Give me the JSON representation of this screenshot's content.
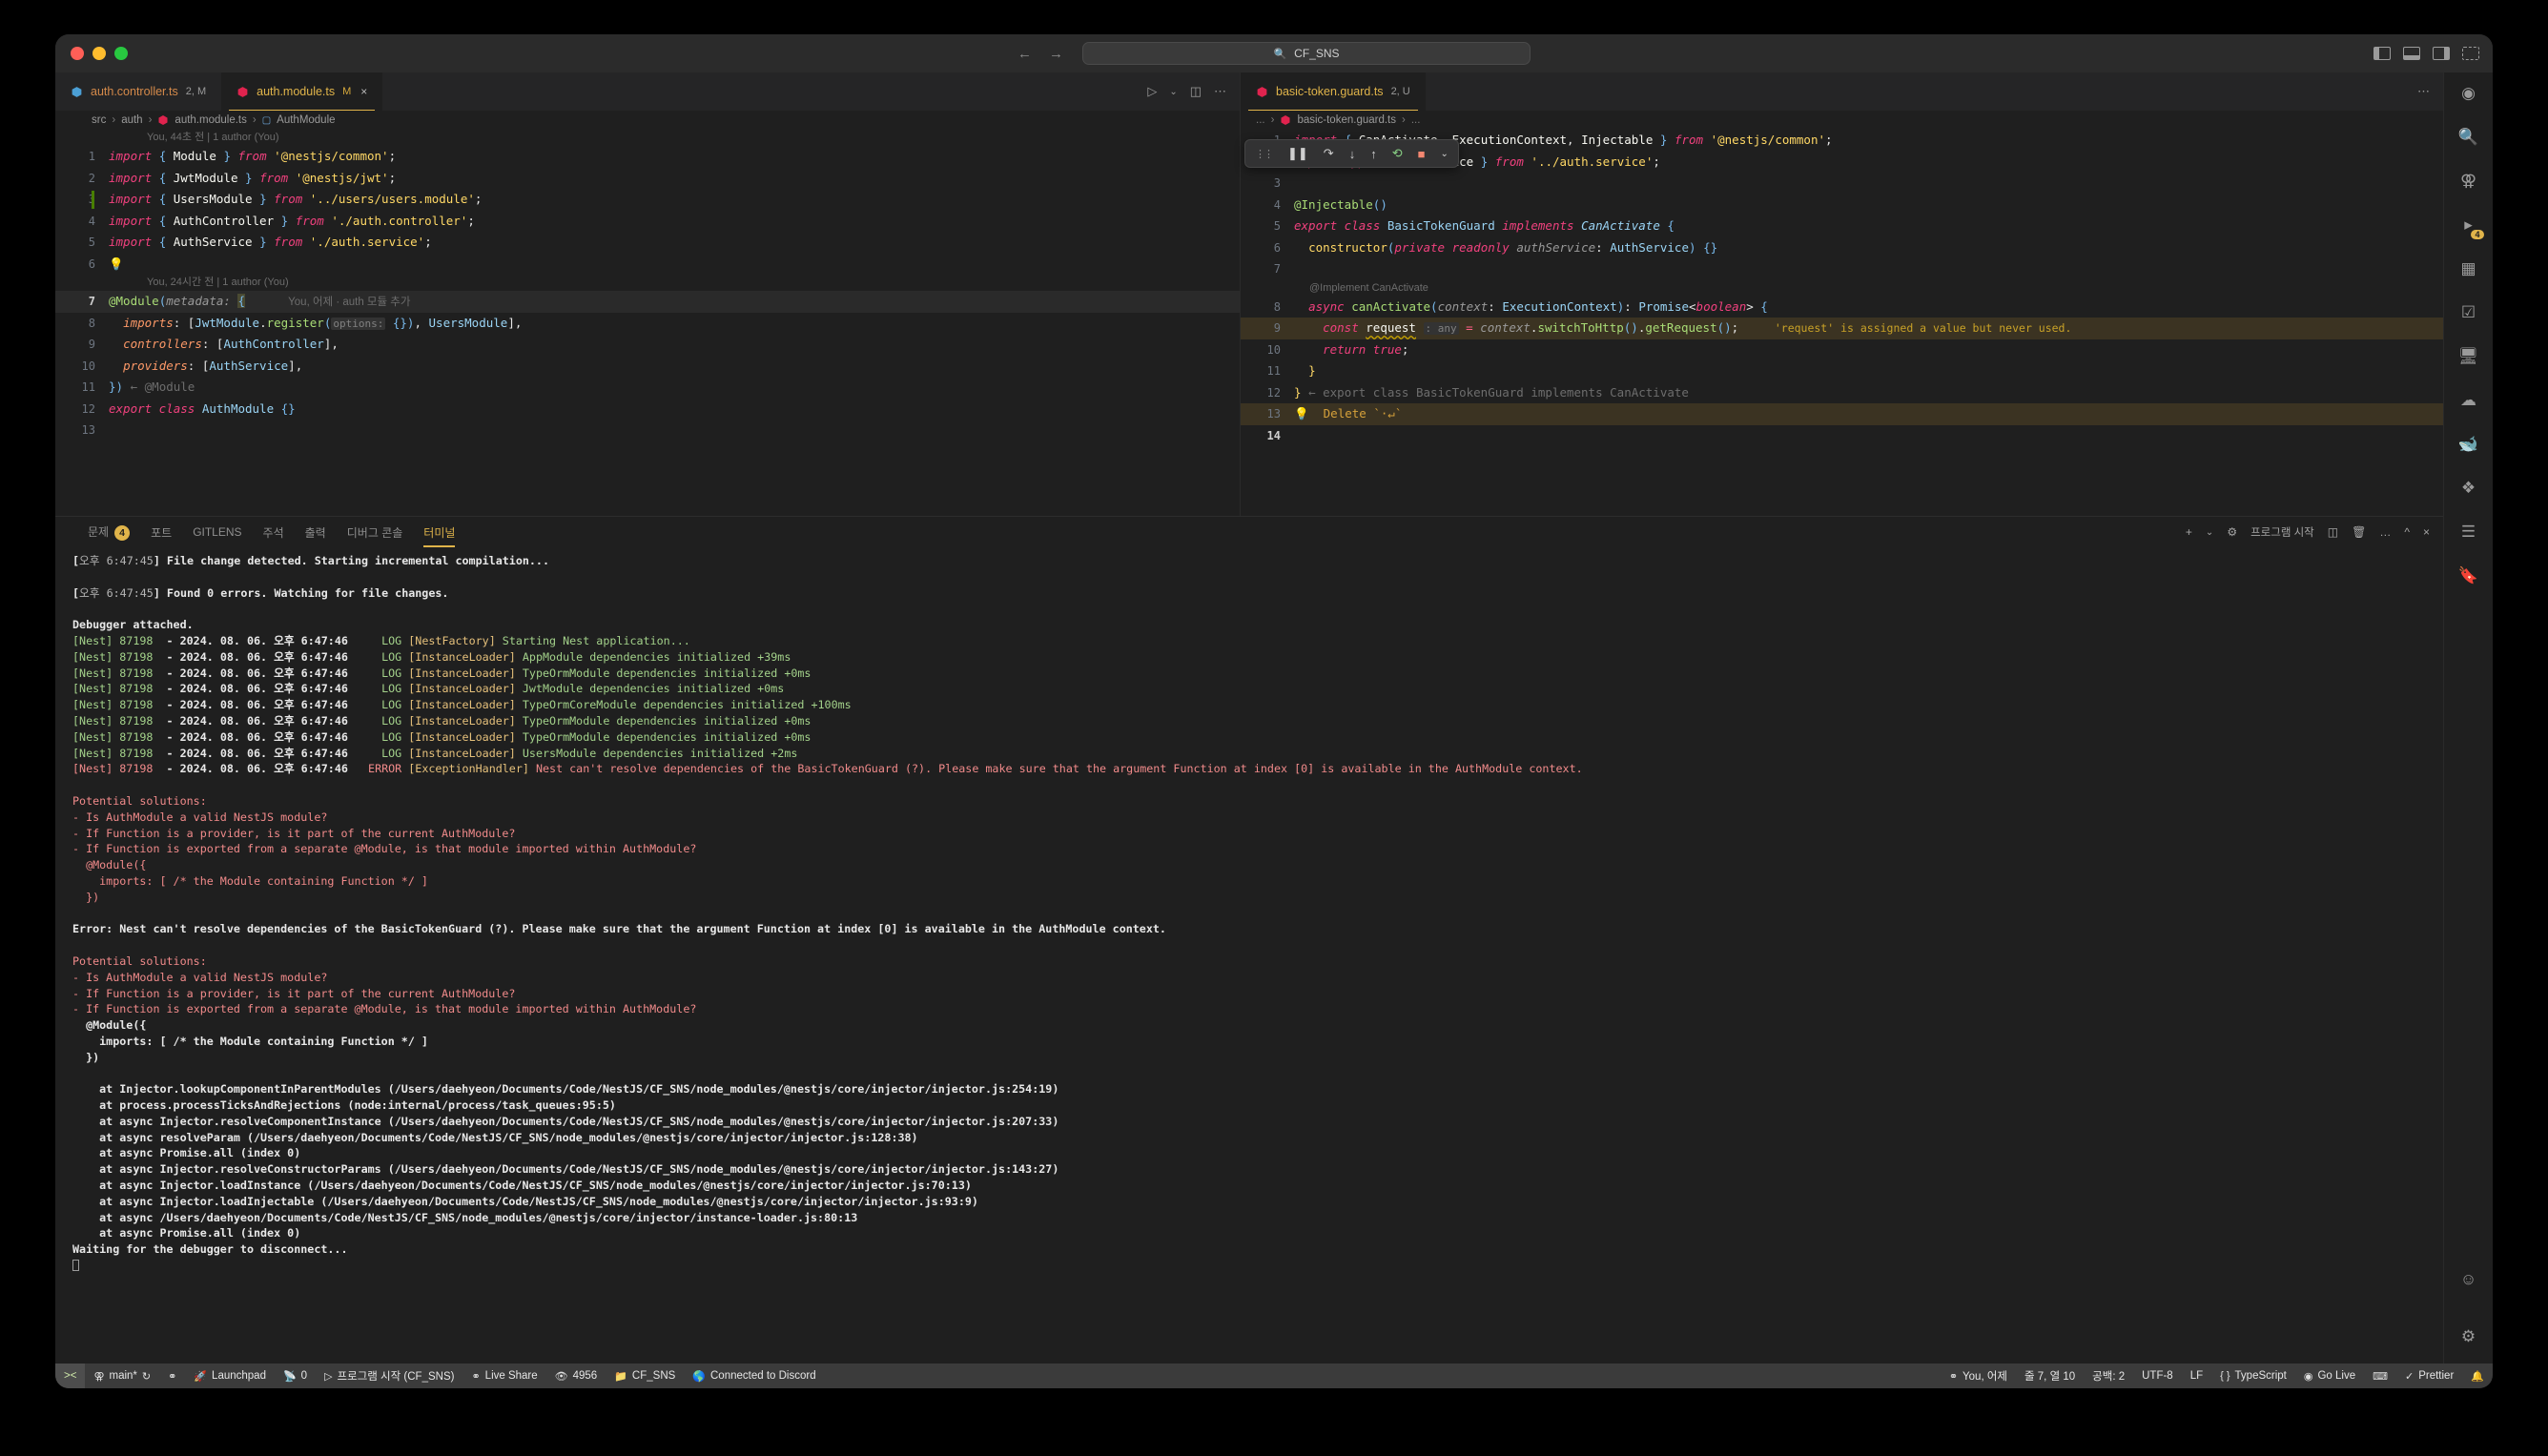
{
  "window": {
    "search_placeholder": "CF_SNS",
    "search_icon": "search-icon"
  },
  "editor_left": {
    "tabs": [
      {
        "label": "auth.controller.ts",
        "badge": "2, M",
        "active": false,
        "icon": "nestjs-icon"
      },
      {
        "label": "auth.module.ts",
        "badge": "M",
        "active": true,
        "icon": "nestjs-icon",
        "close": "×"
      }
    ],
    "breadcrumb": [
      "src",
      "auth",
      "auth.module.ts",
      "AuthModule"
    ],
    "blame": "You, 44초 전 | 1 author (You)",
    "codelens": "You, 24시간 전 | 1 author (You)",
    "inline_blame": "You, 어제 · auth 모듈 추가",
    "lines": [
      {
        "n": "1",
        "text": "import { Module } from '@nestjs/common';"
      },
      {
        "n": "2",
        "text": "import { JwtModule } from '@nestjs/jwt';"
      },
      {
        "n": "3",
        "text": "import { UsersModule } from '../users/users.module';"
      },
      {
        "n": "4",
        "text": "import { AuthController } from './auth.controller';"
      },
      {
        "n": "5",
        "text": "import { AuthService } from './auth.service';"
      },
      {
        "n": "6",
        "text": ""
      },
      {
        "n": "7",
        "text": "@Module(metadata: {"
      },
      {
        "n": "8",
        "text": "  imports: [JwtModule.register(options: {}), UsersModule],"
      },
      {
        "n": "9",
        "text": "  controllers: [AuthController],"
      },
      {
        "n": "10",
        "text": "  providers: [AuthService],"
      },
      {
        "n": "11",
        "text": "}) ← @Module"
      },
      {
        "n": "12",
        "text": "export class AuthModule {}"
      },
      {
        "n": "13",
        "text": ""
      }
    ]
  },
  "editor_right": {
    "tab": {
      "label": "basic-token.guard.ts",
      "badge": "2, U",
      "icon": "nestjs-icon"
    },
    "breadcrumb": [
      "...",
      "basic-token.guard.ts",
      "..."
    ],
    "debug_toolbar": {
      "buttons": [
        "grip",
        "pause-icon",
        "step-over-icon",
        "step-into-icon",
        "step-out-icon",
        "restart-icon",
        "stop-icon",
        "chevron-down-icon"
      ]
    },
    "codelens": "@Implement CanActivate",
    "warning_text": "'request' is assigned a value but never used.",
    "quickfix_text": "Delete `·↵`",
    "foldmsg": "← export class BasicTokenGuard implements CanActivate",
    "lines": [
      {
        "n": "1",
        "text": "import { CanActivate, ExecutionContext, Injectable } from '@nestjs/common';"
      },
      {
        "n": "2",
        "text": "import type { AuthService } from '../auth.service';"
      },
      {
        "n": "3",
        "text": ""
      },
      {
        "n": "4",
        "text": "@Injectable()"
      },
      {
        "n": "5",
        "text": "export class BasicTokenGuard implements CanActivate {"
      },
      {
        "n": "6",
        "text": "  constructor(private readonly authService: AuthService) {}"
      },
      {
        "n": "7",
        "text": ""
      },
      {
        "n": "8",
        "text": "  async canActivate(context: ExecutionContext): Promise<boolean> {"
      },
      {
        "n": "9",
        "text": "    const request : any = context.switchToHttp().getRequest();"
      },
      {
        "n": "10",
        "text": "    return true;"
      },
      {
        "n": "11",
        "text": "  }"
      },
      {
        "n": "12",
        "text": "}"
      },
      {
        "n": "13",
        "text": ""
      },
      {
        "n": "14",
        "text": ""
      }
    ]
  },
  "panel": {
    "tabs": [
      {
        "label": "문제",
        "badge": "4",
        "active": false
      },
      {
        "label": "포트",
        "active": false
      },
      {
        "label": "GITLENS",
        "active": false
      },
      {
        "label": "주석",
        "active": false
      },
      {
        "label": "출력",
        "active": false
      },
      {
        "label": "디버그 콘솔",
        "active": false
      },
      {
        "label": "터미널",
        "active": true
      }
    ],
    "actions": {
      "new_terminal": "+",
      "chevron": "⌄",
      "launch_profile": "프로그램 시작",
      "split": "split-icon",
      "trash": "trash-icon",
      "more": "…",
      "maximize": "^",
      "close": "×"
    },
    "terminal_lines": [
      {
        "segs": [
          {
            "t": "[",
            "c": "t-white"
          },
          {
            "t": "오후 6:47:45",
            "c": "t-grey"
          },
          {
            "t": "] File change detected. Starting incremental compilation...",
            "c": "t-white"
          }
        ]
      },
      {
        "segs": []
      },
      {
        "segs": [
          {
            "t": "[",
            "c": "t-white"
          },
          {
            "t": "오후 6:47:45",
            "c": "t-grey"
          },
          {
            "t": "] Found 0 errors. Watching for file changes.",
            "c": "t-white"
          }
        ]
      },
      {
        "segs": []
      },
      {
        "segs": [
          {
            "t": "Debugger attached.",
            "c": "t-white"
          }
        ]
      },
      {
        "segs": [
          {
            "t": "[Nest] 87198",
            "c": "t-lgreen"
          },
          {
            "t": "  - 2024. 08. 06. 오후 6:47:46     ",
            "c": "t-white"
          },
          {
            "t": "LOG",
            "c": "t-lgreen"
          },
          {
            "t": " [NestFactory] ",
            "c": "t-yellow"
          },
          {
            "t": "Starting Nest application...",
            "c": "t-lgreen"
          }
        ]
      },
      {
        "segs": [
          {
            "t": "[Nest] 87198",
            "c": "t-lgreen"
          },
          {
            "t": "  - 2024. 08. 06. 오후 6:47:46     ",
            "c": "t-white"
          },
          {
            "t": "LOG",
            "c": "t-lgreen"
          },
          {
            "t": " [InstanceLoader] ",
            "c": "t-yellow"
          },
          {
            "t": "AppModule dependencies initialized +39ms",
            "c": "t-lgreen"
          }
        ]
      },
      {
        "segs": [
          {
            "t": "[Nest] 87198",
            "c": "t-lgreen"
          },
          {
            "t": "  - 2024. 08. 06. 오후 6:47:46     ",
            "c": "t-white"
          },
          {
            "t": "LOG",
            "c": "t-lgreen"
          },
          {
            "t": " [InstanceLoader] ",
            "c": "t-yellow"
          },
          {
            "t": "TypeOrmModule dependencies initialized +0ms",
            "c": "t-lgreen"
          }
        ]
      },
      {
        "segs": [
          {
            "t": "[Nest] 87198",
            "c": "t-lgreen"
          },
          {
            "t": "  - 2024. 08. 06. 오후 6:47:46     ",
            "c": "t-white"
          },
          {
            "t": "LOG",
            "c": "t-lgreen"
          },
          {
            "t": " [InstanceLoader] ",
            "c": "t-yellow"
          },
          {
            "t": "JwtModule dependencies initialized +0ms",
            "c": "t-lgreen"
          }
        ]
      },
      {
        "segs": [
          {
            "t": "[Nest] 87198",
            "c": "t-lgreen"
          },
          {
            "t": "  - 2024. 08. 06. 오후 6:47:46     ",
            "c": "t-white"
          },
          {
            "t": "LOG",
            "c": "t-lgreen"
          },
          {
            "t": " [InstanceLoader] ",
            "c": "t-yellow"
          },
          {
            "t": "TypeOrmCoreModule dependencies initialized +100ms",
            "c": "t-lgreen"
          }
        ]
      },
      {
        "segs": [
          {
            "t": "[Nest] 87198",
            "c": "t-lgreen"
          },
          {
            "t": "  - 2024. 08. 06. 오후 6:47:46     ",
            "c": "t-white"
          },
          {
            "t": "LOG",
            "c": "t-lgreen"
          },
          {
            "t": " [InstanceLoader] ",
            "c": "t-yellow"
          },
          {
            "t": "TypeOrmModule dependencies initialized +0ms",
            "c": "t-lgreen"
          }
        ]
      },
      {
        "segs": [
          {
            "t": "[Nest] 87198",
            "c": "t-lgreen"
          },
          {
            "t": "  - 2024. 08. 06. 오후 6:47:46     ",
            "c": "t-white"
          },
          {
            "t": "LOG",
            "c": "t-lgreen"
          },
          {
            "t": " [InstanceLoader] ",
            "c": "t-yellow"
          },
          {
            "t": "TypeOrmModule dependencies initialized +0ms",
            "c": "t-lgreen"
          }
        ]
      },
      {
        "segs": [
          {
            "t": "[Nest] 87198",
            "c": "t-lgreen"
          },
          {
            "t": "  - 2024. 08. 06. 오후 6:47:46     ",
            "c": "t-white"
          },
          {
            "t": "LOG",
            "c": "t-lgreen"
          },
          {
            "t": " [InstanceLoader] ",
            "c": "t-yellow"
          },
          {
            "t": "UsersModule dependencies initialized +2ms",
            "c": "t-lgreen"
          }
        ]
      },
      {
        "segs": [
          {
            "t": "[Nest] 87198",
            "c": "t-pink"
          },
          {
            "t": "  - 2024. 08. 06. 오후 6:47:46   ",
            "c": "t-white"
          },
          {
            "t": "ERROR",
            "c": "t-pink"
          },
          {
            "t": " [ExceptionHandler] ",
            "c": "t-yellow"
          },
          {
            "t": "Nest can't resolve dependencies of the BasicTokenGuard (?). Please make sure that the argument Function at index [0] is available in the AuthModule context.",
            "c": "t-pink"
          }
        ]
      },
      {
        "segs": []
      },
      {
        "segs": [
          {
            "t": "Potential solutions:",
            "c": "t-pink"
          }
        ]
      },
      {
        "segs": [
          {
            "t": "- Is AuthModule a valid NestJS module?",
            "c": "t-pink"
          }
        ]
      },
      {
        "segs": [
          {
            "t": "- If Function is a provider, is it part of the current AuthModule?",
            "c": "t-pink"
          }
        ]
      },
      {
        "segs": [
          {
            "t": "- If Function is exported from a separate @Module, is that module imported within AuthModule?",
            "c": "t-pink"
          }
        ]
      },
      {
        "segs": [
          {
            "t": "  @Module({",
            "c": "t-pink"
          }
        ]
      },
      {
        "segs": [
          {
            "t": "    imports: [ /* the Module containing Function */ ]",
            "c": "t-pink"
          }
        ]
      },
      {
        "segs": [
          {
            "t": "  })",
            "c": "t-pink"
          }
        ]
      },
      {
        "segs": []
      },
      {
        "segs": [
          {
            "t": "Error: Nest can't resolve dependencies of the BasicTokenGuard (?). Please make sure that the argument Function at index [0] is available in the AuthModule context.",
            "c": "t-white"
          }
        ]
      },
      {
        "segs": []
      },
      {
        "segs": [
          {
            "t": "Potential solutions:",
            "c": "t-pink"
          }
        ]
      },
      {
        "segs": [
          {
            "t": "- Is AuthModule a valid NestJS module?",
            "c": "t-pink"
          }
        ]
      },
      {
        "segs": [
          {
            "t": "- If Function is a provider, is it part of the current AuthModule?",
            "c": "t-pink"
          }
        ]
      },
      {
        "segs": [
          {
            "t": "- If Function is exported from a separate @Module, is that module imported within AuthModule?",
            "c": "t-pink"
          }
        ]
      },
      {
        "segs": [
          {
            "t": "  @Module({",
            "c": "t-white"
          }
        ]
      },
      {
        "segs": [
          {
            "t": "    imports: [ /* the Module containing Function */ ]",
            "c": "t-white"
          }
        ]
      },
      {
        "segs": [
          {
            "t": "  })",
            "c": "t-white"
          }
        ]
      },
      {
        "segs": []
      },
      {
        "segs": [
          {
            "t": "    at Injector.lookupComponentInParentModules (/Users/daehyeon/Documents/Code/NestJS/CF_SNS/node_modules/@nestjs/core/injector/injector.js:254:19)",
            "c": "t-white"
          }
        ]
      },
      {
        "segs": [
          {
            "t": "    at process.processTicksAndRejections (node:internal/process/task_queues:95:5)",
            "c": "t-white"
          }
        ]
      },
      {
        "segs": [
          {
            "t": "    at async Injector.resolveComponentInstance (/Users/daehyeon/Documents/Code/NestJS/CF_SNS/node_modules/@nestjs/core/injector/injector.js:207:33)",
            "c": "t-white"
          }
        ]
      },
      {
        "segs": [
          {
            "t": "    at async resolveParam (/Users/daehyeon/Documents/Code/NestJS/CF_SNS/node_modules/@nestjs/core/injector/injector.js:128:38)",
            "c": "t-white"
          }
        ]
      },
      {
        "segs": [
          {
            "t": "    at async Promise.all (index 0)",
            "c": "t-white"
          }
        ]
      },
      {
        "segs": [
          {
            "t": "    at async Injector.resolveConstructorParams (/Users/daehyeon/Documents/Code/NestJS/CF_SNS/node_modules/@nestjs/core/injector/injector.js:143:27)",
            "c": "t-white"
          }
        ]
      },
      {
        "segs": [
          {
            "t": "    at async Injector.loadInstance (/Users/daehyeon/Documents/Code/NestJS/CF_SNS/node_modules/@nestjs/core/injector/injector.js:70:13)",
            "c": "t-white"
          }
        ]
      },
      {
        "segs": [
          {
            "t": "    at async Injector.loadInjectable (/Users/daehyeon/Documents/Code/NestJS/CF_SNS/node_modules/@nestjs/core/injector/injector.js:93:9)",
            "c": "t-white"
          }
        ]
      },
      {
        "segs": [
          {
            "t": "    at async /Users/daehyeon/Documents/Code/NestJS/CF_SNS/node_modules/@nestjs/core/injector/instance-loader.js:80:13",
            "c": "t-white"
          }
        ]
      },
      {
        "segs": [
          {
            "t": "    at async Promise.all (index 0)",
            "c": "t-white"
          }
        ]
      },
      {
        "segs": [
          {
            "t": "Waiting for the debugger to disconnect...",
            "c": "t-white"
          }
        ]
      }
    ]
  },
  "statusbar": {
    "remote": "><",
    "left": [
      {
        "icon": "source-control-icon",
        "label": "main*",
        "suffix": "↺"
      },
      {
        "icon": "sync-icon",
        "label": ""
      },
      {
        "icon": "rocket-icon",
        "label": "Launchpad"
      },
      {
        "icon": "radio-tower-icon",
        "label": "0"
      },
      {
        "icon": "debug-start-icon",
        "label": "프로그램 시작 (CF_SNS)"
      },
      {
        "icon": "live-share-icon",
        "label": "Live Share"
      },
      {
        "icon": "eye-icon",
        "label": "4956"
      },
      {
        "icon": "folder-icon",
        "label": "CF_SNS"
      },
      {
        "icon": "globe-icon",
        "label": "Connected to Discord"
      }
    ],
    "right": [
      {
        "icon": "git-blame-icon",
        "label": "You, 어제"
      },
      {
        "icon": "",
        "label": "줄 7, 열 10"
      },
      {
        "icon": "",
        "label": "공백: 2"
      },
      {
        "icon": "",
        "label": "UTF-8"
      },
      {
        "icon": "",
        "label": "LF"
      },
      {
        "icon": "braces-icon",
        "label": "TypeScript"
      },
      {
        "icon": "broadcast-icon",
        "label": "Go Live"
      },
      {
        "icon": "keyboard-icon",
        "label": ""
      },
      {
        "icon": "check-icon",
        "label": "Prettier"
      },
      {
        "icon": "bell-icon",
        "label": ""
      }
    ]
  },
  "activitybar": {
    "items": [
      {
        "icon": "copilot-icon"
      },
      {
        "icon": "search-icon"
      },
      {
        "icon": "source-control-icon"
      },
      {
        "icon": "debug-icon"
      },
      {
        "icon": "extensions-icon"
      },
      {
        "icon": "testing-icon"
      },
      {
        "icon": "remote-icon"
      },
      {
        "icon": "database-icon"
      },
      {
        "icon": "docker-icon"
      },
      {
        "icon": "gitlens-icon"
      },
      {
        "icon": "todo-icon"
      },
      {
        "icon": "bookmark-icon"
      },
      {
        "icon": "account-icon"
      },
      {
        "icon": "gear-icon"
      }
    ]
  }
}
